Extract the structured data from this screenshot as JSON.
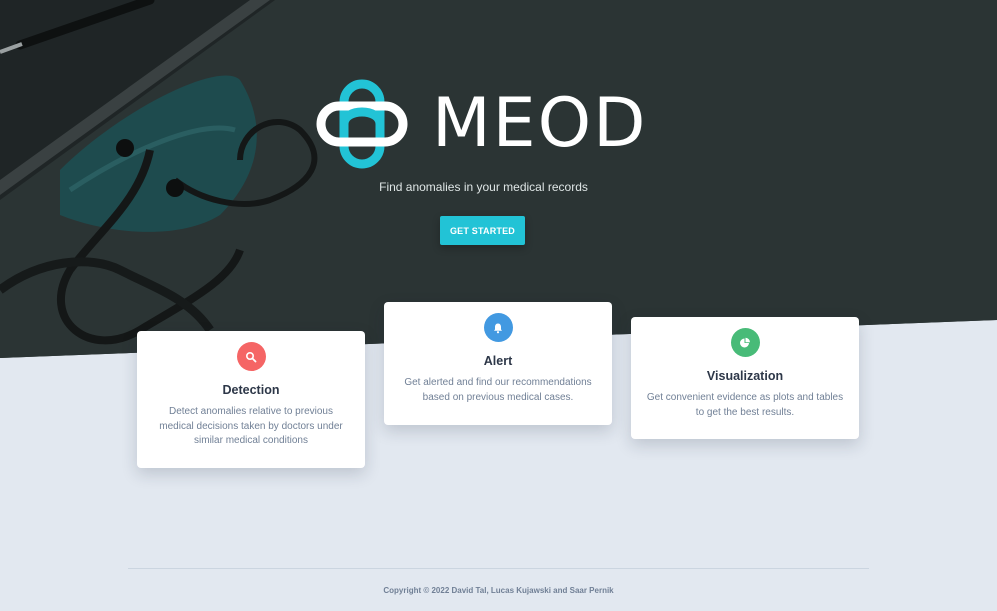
{
  "brand": {
    "name": "MEOD",
    "tagline": "Find anomalies in your medical records",
    "cta_label": "GET STARTED"
  },
  "features": [
    {
      "icon": "search-icon",
      "color": "#f56565",
      "title": "Detection",
      "description": "Detect anomalies relative to previous medical decisions taken by doctors under similar medical conditions"
    },
    {
      "icon": "bell-icon",
      "color": "#4299e1",
      "title": "Alert",
      "description": "Get alerted and find our recommendations based on previous medical cases."
    },
    {
      "icon": "pie-chart-icon",
      "color": "#48bb78",
      "title": "Visualization",
      "description": "Get convenient evidence as plots and tables to get the best results."
    }
  ],
  "colors": {
    "accent": "#22c3d6",
    "hero_bg": "#2b3434",
    "page_bg": "#e2e8f0"
  },
  "footer": {
    "copyright": "Copyright © 2022 David Tal, Lucas Kujawski and Saar Pernik"
  }
}
